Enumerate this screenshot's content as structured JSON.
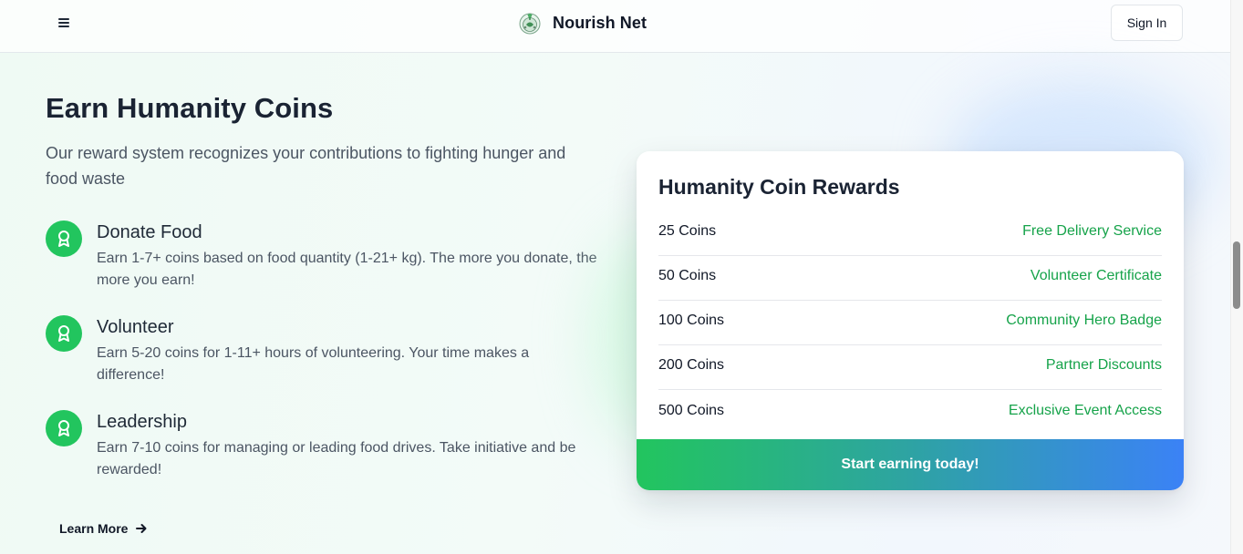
{
  "header": {
    "brand": "Nourish Net",
    "menu_icon": "hamburger-icon",
    "logo_icon": "nourish-net-logo",
    "sign_in": "Sign In"
  },
  "hero": {
    "title": "Earn Humanity Coins",
    "subtitle": "Our reward system recognizes your contributions to fighting hunger and food waste"
  },
  "features": [
    {
      "title": "Donate Food",
      "description": "Earn 1-7+ coins based on food quantity (1-21+ kg). The more you donate, the more you earn!",
      "icon": "award-icon"
    },
    {
      "title": "Volunteer",
      "description": "Earn 5-20 coins for 1-11+ hours of volunteering. Your time makes a difference!",
      "icon": "award-icon"
    },
    {
      "title": "Leadership",
      "description": "Earn 7-10 coins for managing or leading food drives. Take initiative and be rewarded!",
      "icon": "award-icon"
    }
  ],
  "learn_more": {
    "label": "Learn More",
    "icon": "arrow-right-icon"
  },
  "rewards": {
    "title": "Humanity Coin Rewards",
    "rows": [
      {
        "coins": "25 Coins",
        "reward": "Free Delivery Service"
      },
      {
        "coins": "50 Coins",
        "reward": "Volunteer Certificate"
      },
      {
        "coins": "100 Coins",
        "reward": "Community Hero Badge"
      },
      {
        "coins": "200 Coins",
        "reward": "Partner Discounts"
      },
      {
        "coins": "500 Coins",
        "reward": "Exclusive Event Access"
      }
    ],
    "cta": "Start earning today!"
  },
  "colors": {
    "accent_green": "#22c55e",
    "reward_text": "#16a34a",
    "cta_gradient_start": "#22c55e",
    "cta_gradient_end": "#3b82f6"
  }
}
